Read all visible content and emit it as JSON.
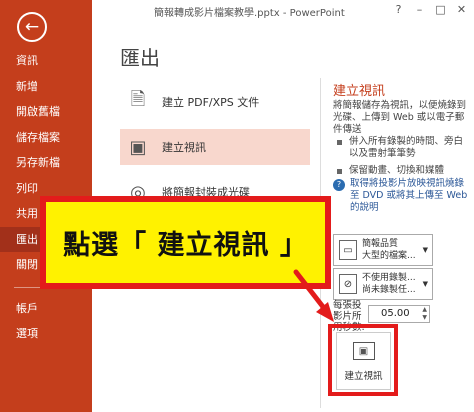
{
  "window": {
    "title": "簡報轉成影片檔案教學.pptx - PowerPoint",
    "controls": [
      "?",
      "–",
      "□",
      "✕"
    ]
  },
  "sidebar": {
    "back_glyph": "←",
    "items": [
      "資訊",
      "新增",
      "開啟舊檔",
      "儲存檔案",
      "另存新檔",
      "列印",
      "共用",
      "匯出",
      "關閉"
    ],
    "active_index": 7,
    "bottom_items": [
      "帳戶",
      "選項"
    ]
  },
  "page_title": "匯出",
  "export_options": [
    {
      "label": "建立 PDF/XPS 文件",
      "icon": "pdf-document-icon",
      "glyph": "🗎"
    },
    {
      "label": "建立視訊",
      "icon": "video-icon",
      "glyph": "▣"
    },
    {
      "label": "將簡報封裝成光碟",
      "icon": "cd-icon",
      "glyph": "◎"
    }
  ],
  "selected_option_index": 1,
  "right_panel": {
    "title": "建立視訊",
    "desc": "將簡報儲存為視訊，以便燒錄到光碟、上傳到 Web 或以電子郵件傳送",
    "bullets": [
      "併入所有錄製的時間、旁白以及雷射筆筆勢",
      "保留動畫、切換和媒體"
    ],
    "help_text": "取得將投影片放映視訊燒錄至 DVD 或將其上傳至 Web 的說明",
    "help_glyph": "?",
    "quality_dropdown": "簡報品質\n大型的檔案...",
    "timing_dropdown": "不使用錄製...\n尚未錄製任...",
    "seconds_label": "每張投影片所用秒數:",
    "seconds_value": "05.00",
    "create_button_label": "建立視訊",
    "spinner_glyph": "▲\n▼",
    "dropdown_glyph": "▼"
  },
  "annotation": {
    "text": "點選「 建立視訊 」",
    "color": "#e31b1b",
    "fill": "#fff200"
  },
  "colors": {
    "accent": "#c43e1c",
    "sidebar_active": "#a2301a",
    "selected_option": "#f8d7cd",
    "link": "#2b5797"
  }
}
